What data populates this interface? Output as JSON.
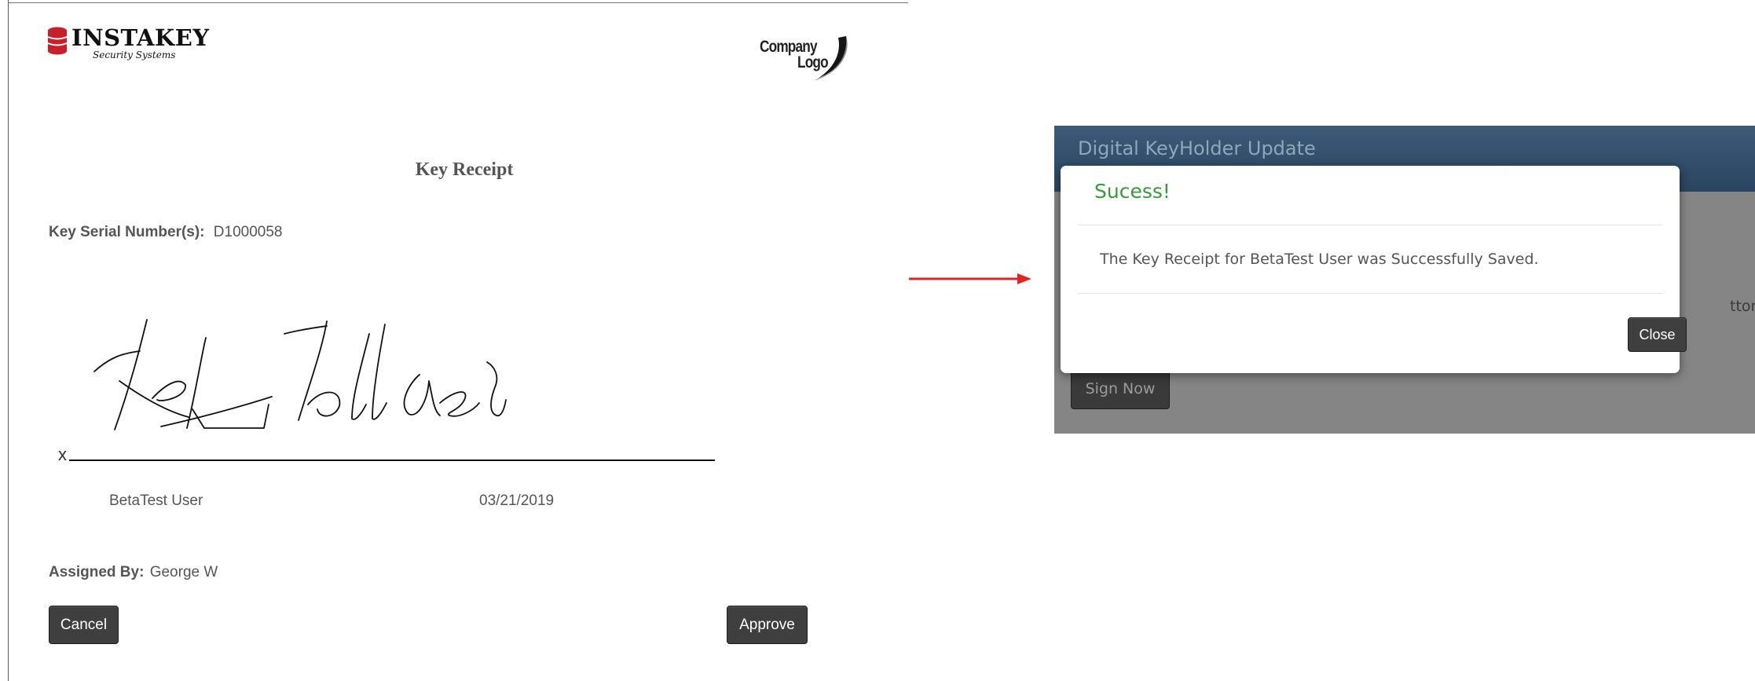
{
  "branding": {
    "brand_name": "INSTAKEY",
    "brand_tagline": "Security Systems",
    "company_logo_line1": "Company",
    "company_logo_line2": "Logo",
    "colors": {
      "brand_red": "#c8202b"
    }
  },
  "receipt": {
    "title": "Key Receipt",
    "serial_label": "Key Serial Number(s):",
    "serial_value": "D1000058",
    "signature_x": "x",
    "signer_name": "BetaTest User",
    "sign_date": "03/21/2019",
    "assigned_by_label": "Assigned By:",
    "assigned_by_value": "George W",
    "cancel_label": "Cancel",
    "approve_label": "Approve"
  },
  "arrow": {
    "color": "#e32222"
  },
  "dialog_screen": {
    "header_title": "Digital KeyHolder Update",
    "peek_text": "tton",
    "sign_now_label": "Sign Now",
    "modal": {
      "title": "Sucess!",
      "message": "The Key Receipt for BetaTest User was Successfully Saved.",
      "close_label": "Close",
      "colors": {
        "title": "#3a9a3a"
      }
    }
  }
}
